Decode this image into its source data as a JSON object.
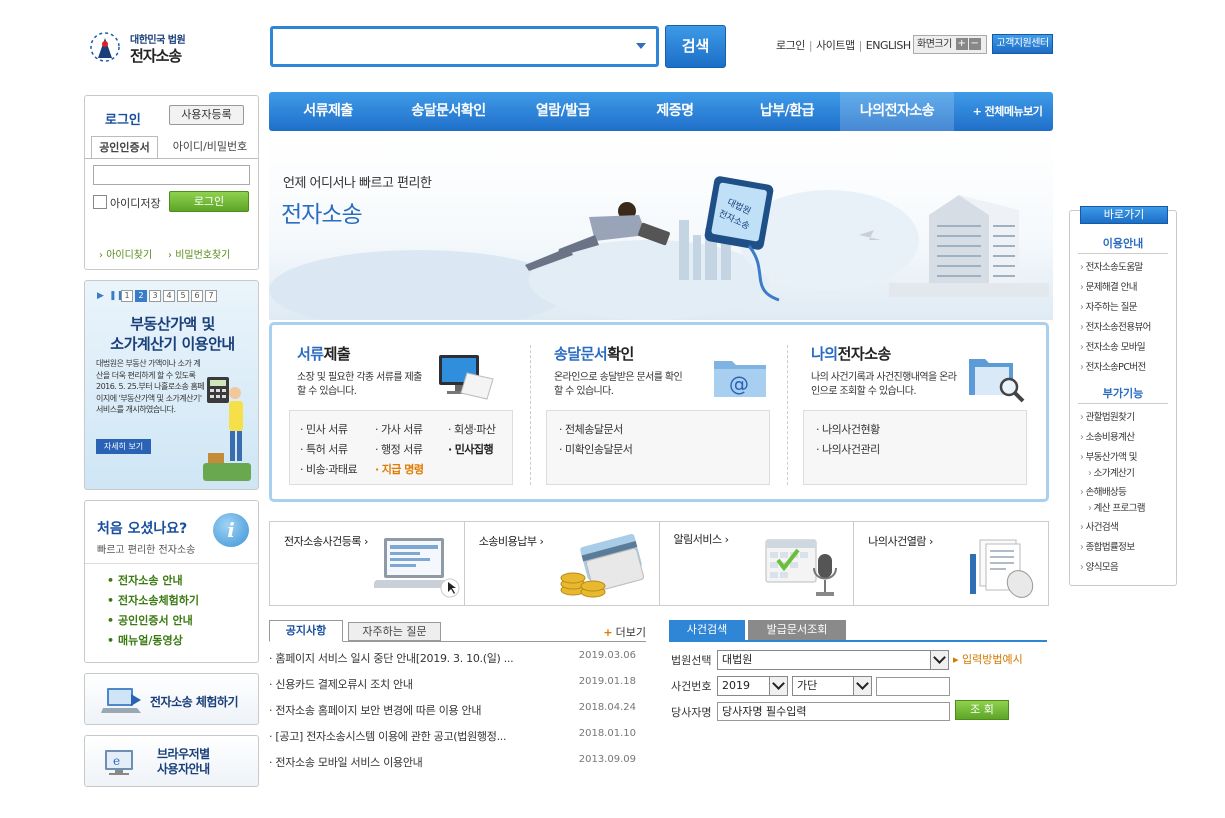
{
  "logo": {
    "line1": "대한민국 법원",
    "line2": "전자소송"
  },
  "search": {
    "placeholder": "",
    "button": "검색"
  },
  "topnav": {
    "login": "로그인",
    "sitemap": "사이트맵",
    "english": "ENGLISH",
    "screen_size": "화면크기",
    "plus": "+",
    "minus": "−",
    "customer_center": "고객지원센터"
  },
  "mainnav": {
    "items": [
      "서류제출",
      "송달문서확인",
      "열람/발급",
      "제증명",
      "납부/환급",
      "나의전자소송"
    ],
    "all_menu": "전체메뉴보기"
  },
  "login_box": {
    "title": "로그인",
    "register": "사용자등록",
    "tab_cert": "공인인증서",
    "tab_id": "아이디/비밀번호",
    "save_id": "아이디저장",
    "login_button": "로그인",
    "find_id": "아이디찾기",
    "find_pw": "비밀번호찾기"
  },
  "promo": {
    "pages": [
      "1",
      "2",
      "3",
      "4",
      "5",
      "6",
      "7"
    ],
    "active_page": "2",
    "title1": "부동산가액 및",
    "title2": "소가계산기 이용안내",
    "body": "대법원은 부동산 가액이나 소가 계산을 더욱 편리하게 할 수 있도록 2016. 5. 25.부터 나홀로소송 홈페이지에 '부동산가액 및 소가계산기' 서비스를 개시하였습니다.",
    "more": "자세히 보기"
  },
  "first_visit": {
    "title": "처음 오셨나요?",
    "subtitle": "빠르고 편리한 전자소송",
    "links": [
      "전자소송 안내",
      "전자소송체험하기",
      "공인인증서 안내",
      "매뉴얼/동영상"
    ]
  },
  "left_buttons": {
    "experience": "전자소송 체험하기",
    "browser1": "브라우저별",
    "browser2": "사용자안내"
  },
  "banner": {
    "line1": "언제 어디서나 빠르고 편리한",
    "line2": "전자소송"
  },
  "services": [
    {
      "title_hl": "서류",
      "title_rest": "제출",
      "desc": "소장 및 필요한 각종 서류를 제출할 수 있습니다.",
      "items": [
        "민사 서류",
        "가사 서류",
        "회생·파산",
        "특허 서류",
        "행정 서류",
        "민사집행",
        "비송·과태료",
        "지급 명령"
      ]
    },
    {
      "title_hl": "송달문서",
      "title_rest": "확인",
      "desc": "온라인으로 송달받은 문서를 확인 할 수 있습니다.",
      "items": [
        "전체송달문서",
        "미확인송달문서"
      ]
    },
    {
      "title_hl": "나의",
      "title_rest": "전자소송",
      "desc": "나의 사건기록과 사건진행내역을 온라인으로 조회할 수 있습니다.",
      "items": [
        "나의사건현황",
        "나의사건관리"
      ]
    }
  ],
  "quick": [
    "전자소송사건등록",
    "소송비용납부",
    "알림서비스",
    "나의사건열람"
  ],
  "notices": {
    "tab1": "공지사항",
    "tab2": "자주하는 질문",
    "more": "더보기",
    "rows": [
      {
        "title": "홈페이지 서비스 일시 중단 안내[2019. 3. 10.(일) ...",
        "date": "2019.03.06"
      },
      {
        "title": "신용카드 결제오류시 조치 안내",
        "date": "2019.01.18"
      },
      {
        "title": "전자소송 홈페이지 보안 변경에 따른 이용 안내",
        "date": "2018.04.24"
      },
      {
        "title": "[공고] 전자소송시스템 이용에 관한 공고(법원행정...",
        "date": "2018.01.10"
      },
      {
        "title": "전자소송 모바일 서비스 이용안내",
        "date": "2013.09.09"
      }
    ]
  },
  "case_search": {
    "tab1": "사건검색",
    "tab2": "발급문서조회",
    "court_label": "법원선택",
    "court_value": "대법원",
    "example": "입력방법예시",
    "case_label": "사건번호",
    "year": "2019",
    "type": "가단",
    "number": "",
    "party_label": "당사자명",
    "party_value": "당사자명 필수입력",
    "search": "조 회"
  },
  "quickmenu": {
    "header": "바로가기",
    "sec1": "이용안내",
    "sec1_items": [
      "전자소송도움말",
      "문제해결 안내",
      "자주하는 질문",
      "전자소송전용뷰어",
      "전자소송 모바일",
      "전자소송PC버전"
    ],
    "sec2": "부가기능",
    "sec2_items": [
      "관할법원찾기",
      "소송비용계산",
      "부동산가액 및",
      "소가계산기",
      "손해배상등",
      "계산 프로그램",
      "사건검색",
      "종합법률정보",
      "양식모음"
    ]
  },
  "colors": {
    "primary": "#2f86d6",
    "accent_green": "#5ea526",
    "accent_orange": "#e07b00"
  }
}
